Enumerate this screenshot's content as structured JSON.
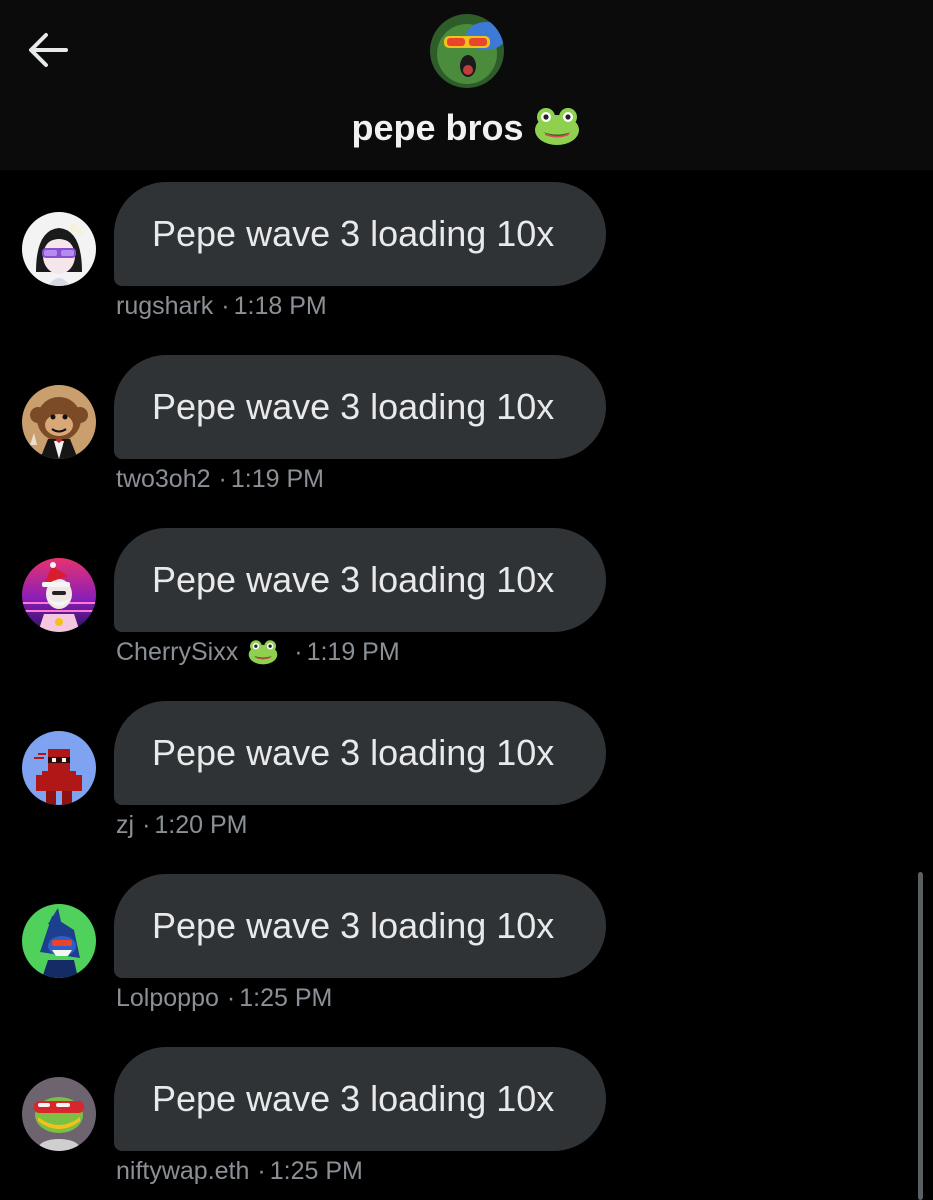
{
  "header": {
    "title": "pepe bros",
    "title_emoji": "frog-emoji",
    "back_icon": "arrow-left-icon"
  },
  "messages": [
    {
      "text": "Pepe wave 3 loading 10x",
      "user": "rugshark",
      "dot": "·",
      "time": "1:18 PM",
      "avatar": "avatar-rugshark"
    },
    {
      "text": "Pepe wave 3 loading 10x",
      "user": "two3oh2",
      "dot": "·",
      "time": "1:19 PM",
      "avatar": "avatar-two3oh2"
    },
    {
      "text": "Pepe wave 3 loading 10x",
      "user": "CherrySixx",
      "dot": "·",
      "time": "1:19 PM",
      "avatar": "avatar-cherrysixx",
      "user_emoji": "frog-emoji"
    },
    {
      "text": "Pepe wave 3 loading 10x",
      "user": "zj",
      "dot": "·",
      "time": "1:20 PM",
      "avatar": "avatar-zj"
    },
    {
      "text": "Pepe wave 3 loading 10x",
      "user": "Lolpoppo",
      "dot": "·",
      "time": "1:25 PM",
      "avatar": "avatar-lolpoppo"
    },
    {
      "text": "Pepe wave 3 loading 10x",
      "user": "niftywap.eth",
      "dot": "·",
      "time": "1:25 PM",
      "avatar": "avatar-niftywap"
    }
  ],
  "colors": {
    "background": "#000000",
    "header_background": "#0b0b0b",
    "bubble": "#2f3336",
    "text": "#e7e9ea",
    "meta_text": "#8b9096"
  }
}
